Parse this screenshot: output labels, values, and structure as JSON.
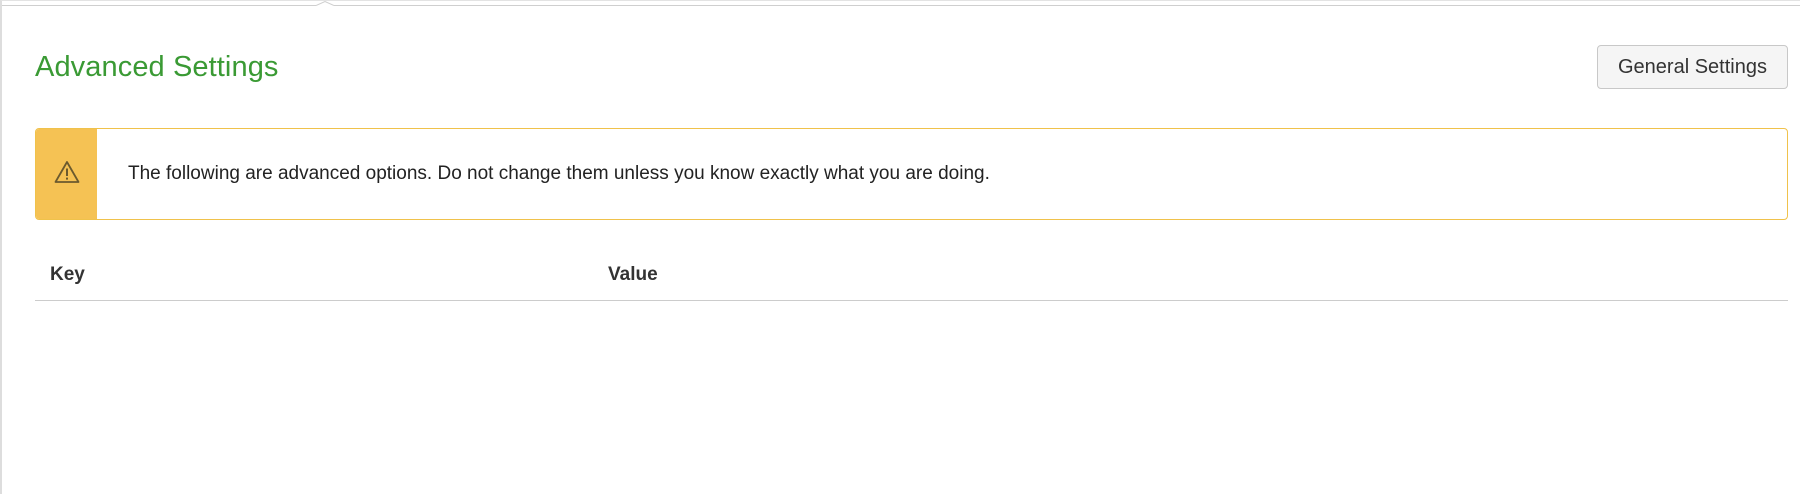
{
  "header": {
    "title": "Advanced Settings",
    "general_settings_label": "General Settings"
  },
  "alert": {
    "icon": "warning-icon",
    "message": "The following are advanced options. Do not change them unless you know exactly what you are doing.",
    "accent_color": "#f5c254"
  },
  "table": {
    "columns": [
      "Key",
      "Value"
    ],
    "rows": []
  },
  "colors": {
    "title": "#3a9a34",
    "alert_border": "#f0c24b"
  }
}
